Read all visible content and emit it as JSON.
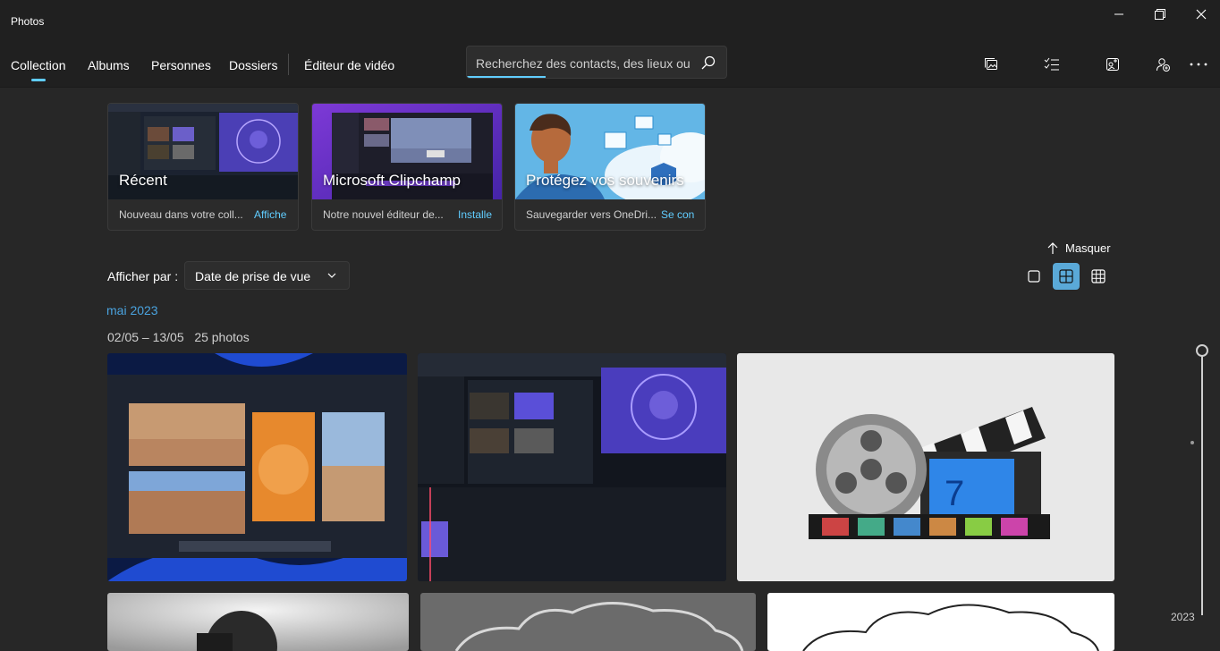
{
  "app": {
    "title": "Photos"
  },
  "window_controls": [
    "minimize-icon",
    "restore-icon",
    "close-icon"
  ],
  "nav": {
    "items": [
      {
        "label": "Collection",
        "selected": true
      },
      {
        "label": "Albums"
      },
      {
        "label": "Personnes"
      },
      {
        "label": "Dossiers"
      },
      {
        "label": "Éditeur de vidéo"
      }
    ]
  },
  "search": {
    "placeholder": "Recherchez des contacts, des lieux ou"
  },
  "toolbar_icons": [
    "import-icon",
    "select-icon",
    "edit-photo-icon",
    "add-account-icon",
    "more-icon"
  ],
  "cards": [
    {
      "title": "Récent",
      "desc": "Nouveau dans votre coll...",
      "link": "Affiche"
    },
    {
      "title": "Microsoft Clipchamp",
      "desc": "Notre nouvel éditeur de...",
      "link": "Installe"
    },
    {
      "title": "Protégez vos souvenirs",
      "desc": "Sauvegarder vers OneDri...",
      "link": "Se con"
    }
  ],
  "hide_label": "Masquer",
  "view": {
    "label": "Afficher par :",
    "selected": "Date de prise de vue"
  },
  "view_modes": [
    "single",
    "medium",
    "small"
  ],
  "active_view_mode": "medium",
  "section": {
    "month": "mai 2023",
    "date_range": "02/05 – 13/05",
    "count": "25 photos"
  },
  "timeline": {
    "year": "2023"
  },
  "colors": {
    "accent": "#60cdff",
    "background": "#272727",
    "titlebar": "#202020"
  }
}
